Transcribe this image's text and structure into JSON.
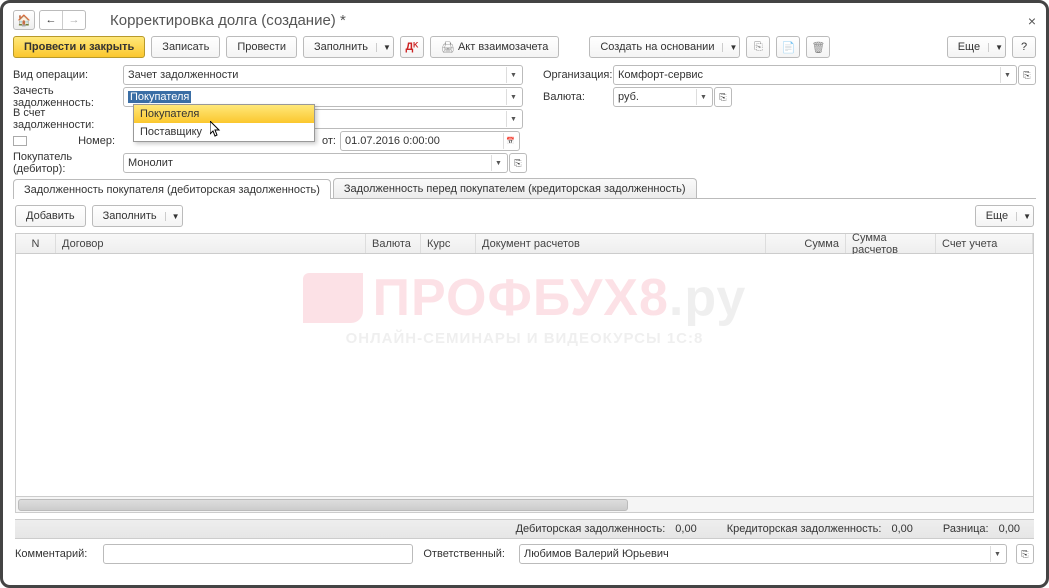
{
  "window": {
    "title": "Корректировка долга (создание) *"
  },
  "toolbar": {
    "post_and_close": "Провести и закрыть",
    "save": "Записать",
    "post": "Провести",
    "fill": "Заполнить",
    "offset_act": "Акт взаимозачета",
    "create_based": "Создать на основании",
    "more": "Еще"
  },
  "form": {
    "label_optype": "Вид операции:",
    "optype_value": "Зачет задолженности",
    "label_offset_debt": "Зачесть задолженность:",
    "offset_debt_value": "Покупателя",
    "label_against_debt": "В счет задолженности:",
    "against_debt_value": "",
    "label_number": "Номер:",
    "number_value": "",
    "label_from": "от:",
    "date_value": "01.07.2016 0:00:00",
    "label_buyer": "Покупатель (дебитор):",
    "buyer_value": "Монолит",
    "label_org": "Организация:",
    "org_value": "Комфорт-сервис",
    "label_currency": "Валюта:",
    "currency_value": "руб."
  },
  "dropdown": {
    "option1": "Покупателя",
    "option2": "Поставщику"
  },
  "tabs": {
    "tab1": "Задолженность покупателя (дебиторская задолженность)",
    "tab2": "Задолженность перед покупателем (кредиторская задолженность)"
  },
  "subtoolbar": {
    "add": "Добавить",
    "fill": "Заполнить",
    "more": "Еще"
  },
  "grid": {
    "cols": {
      "n": "N",
      "contract": "Договор",
      "currency": "Валюта",
      "rate": "Курс",
      "doc": "Документ расчетов",
      "sum": "Сумма",
      "calc_sum": "Сумма расчетов",
      "account": "Счет учета"
    }
  },
  "watermark": {
    "brand": "ПРОФБУХ8",
    "suffix": ".ру",
    "sub": "ОНЛАЙН-СЕМИНАРЫ И ВИДЕОКУРСЫ 1С:8"
  },
  "totals": {
    "receivable_label": "Дебиторская задолженность:",
    "receivable_value": "0,00",
    "payable_label": "Кредиторская задолженность:",
    "payable_value": "0,00",
    "diff_label": "Разница:",
    "diff_value": "0,00"
  },
  "footer": {
    "label_comment": "Комментарий:",
    "comment_value": "",
    "label_responsible": "Ответственный:",
    "responsible_value": "Любимов Валерий Юрьевич"
  }
}
